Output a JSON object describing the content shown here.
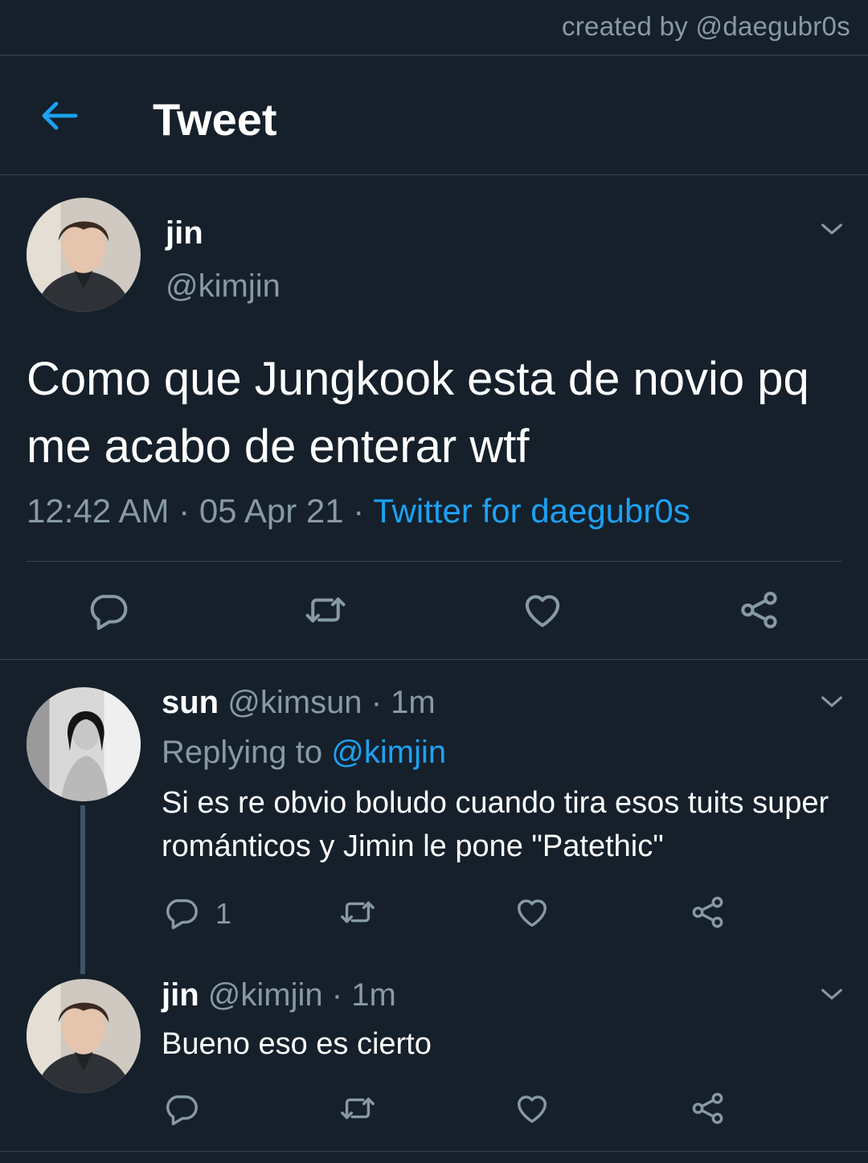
{
  "credit": "created by @daegubr0s",
  "header": {
    "title": "Tweet"
  },
  "main_tweet": {
    "name": "jin",
    "handle": "@kimjin",
    "text": "Como que Jungkook esta de novio pq me acabo de enterar wtf",
    "time": "12:42 AM",
    "date": "05 Apr 21",
    "source": "Twitter for daegubr0s"
  },
  "replies": [
    {
      "name": "sun",
      "handle": "@kimsun",
      "time": "1m",
      "replying_prefix": "Replying to",
      "replying_to": "@kimjin",
      "text": "Si es re obvio boludo cuando tira esos tuits super románticos y Jimin le pone \"Patethic\"",
      "reply_count": "1"
    },
    {
      "name": "jin",
      "handle": "@kimjin",
      "time": "1m",
      "text": "Bueno eso es cierto"
    }
  ],
  "separator": "·",
  "colors": {
    "background": "#15202b",
    "accent": "#1da1f2",
    "muted": "#8899a6",
    "border": "#38444d"
  },
  "icons": [
    "back-arrow-icon",
    "chevron-down-icon",
    "reply-icon",
    "retweet-icon",
    "like-icon",
    "share-icon"
  ]
}
